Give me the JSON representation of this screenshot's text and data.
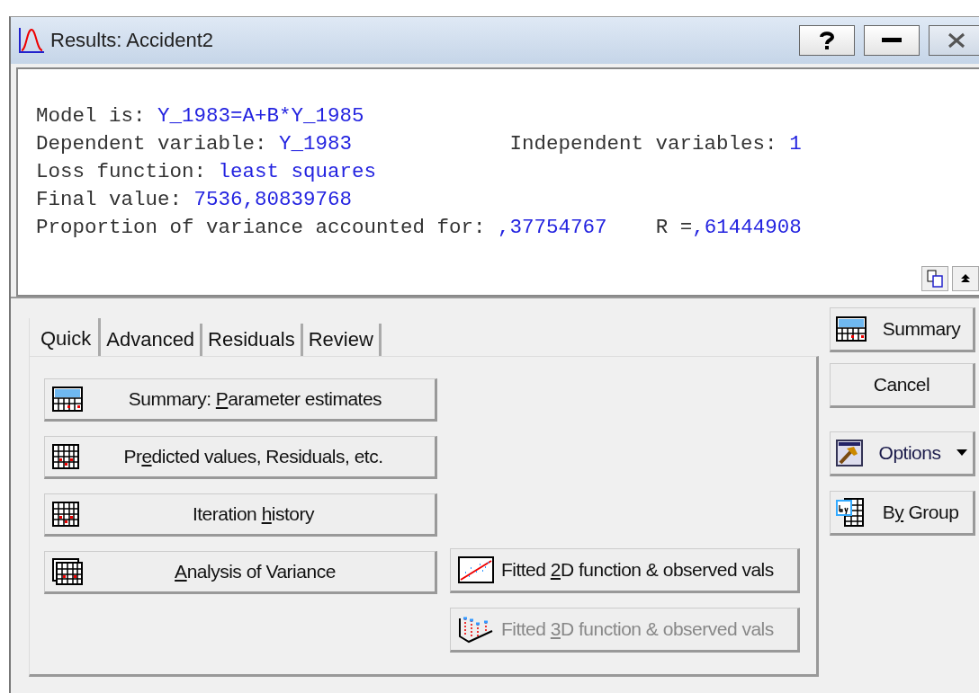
{
  "window": {
    "title": "Results: Accident2"
  },
  "output": {
    "lines": [
      {
        "items": [
          {
            "label": "Model is: ",
            "value": "Y_1983=A+B*Y_1985"
          }
        ]
      },
      {
        "items": [
          {
            "label": "Dependent variable: ",
            "value": "Y_1983"
          },
          {
            "label": "Independent variables: ",
            "value": "1"
          }
        ]
      },
      {
        "items": [
          {
            "label": "Loss function: ",
            "value": "least squares"
          }
        ]
      },
      {
        "items": [
          {
            "label": "Final value: ",
            "value": "7536,80839768"
          }
        ]
      },
      {
        "items": [
          {
            "label": "Proportion of variance accounted for: ",
            "value": ",37754767"
          },
          {
            "label": "R =",
            "value": ",61444908"
          }
        ]
      }
    ]
  },
  "tabs": [
    {
      "label": "Quick",
      "selected": true
    },
    {
      "label": "Advanced",
      "selected": false
    },
    {
      "label": "Residuals",
      "selected": false
    },
    {
      "label": "Review",
      "selected": false
    }
  ],
  "quick_buttons": [
    {
      "kind": "summary",
      "before": "Summary: ",
      "key": "P",
      "after": "arameter estimates",
      "disabled": false
    },
    {
      "kind": "grid",
      "before": "Pr",
      "key": "e",
      "after": "dicted values, Residuals, etc.",
      "disabled": false
    },
    {
      "kind": "grid",
      "before": "Iteration ",
      "key": "h",
      "after": "istory",
      "disabled": false
    },
    {
      "kind": "stack",
      "key": "A",
      "after": "nalysis of Variance",
      "disabled": false
    },
    {
      "kind": "plot2d",
      "before": "Fitted ",
      "key": "2",
      "after": "D function & observed vals",
      "disabled": false
    },
    {
      "kind": "plot3d",
      "before": "Fitted ",
      "key": "3",
      "after": "D function & observed vals",
      "disabled": true
    }
  ],
  "side_buttons": [
    {
      "kind": "summary",
      "before": "Summary"
    },
    {
      "kind": "plain",
      "before": "Cancel"
    },
    {
      "kind": "options",
      "before": "Options"
    },
    {
      "kind": "bygroup",
      "before": "B",
      "key": "y",
      "after": " Group"
    }
  ]
}
